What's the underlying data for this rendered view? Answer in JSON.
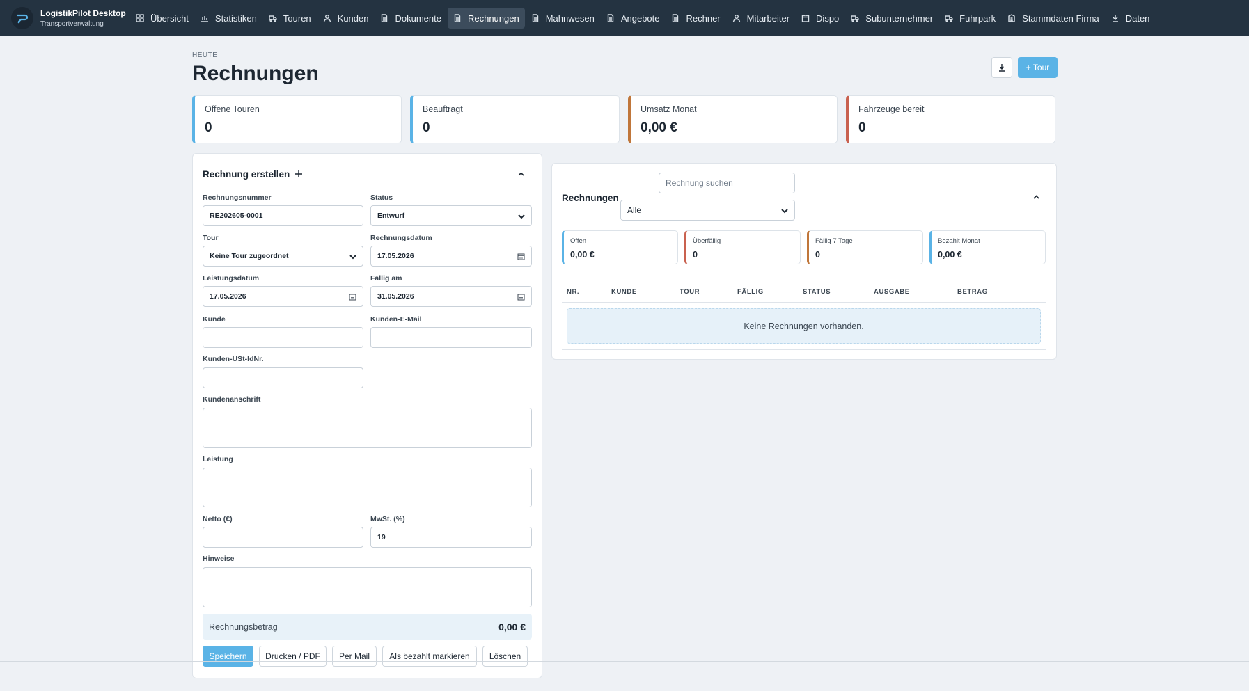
{
  "app": {
    "title": "LogistikPilot Desktop",
    "subtitle": "Transportverwaltung"
  },
  "nav": [
    {
      "label": "Übersicht",
      "icon": "dashboard-icon"
    },
    {
      "label": "Statistiken",
      "icon": "chart-icon"
    },
    {
      "label": "Touren",
      "icon": "truck-icon"
    },
    {
      "label": "Kunden",
      "icon": "user-icon"
    },
    {
      "label": "Dokumente",
      "icon": "document-icon"
    },
    {
      "label": "Rechnungen",
      "icon": "document-icon",
      "active": true
    },
    {
      "label": "Mahnwesen",
      "icon": "document-icon"
    },
    {
      "label": "Angebote",
      "icon": "document-icon"
    },
    {
      "label": "Rechner",
      "icon": "document-icon"
    },
    {
      "label": "Mitarbeiter",
      "icon": "user-icon"
    },
    {
      "label": "Dispo",
      "icon": "calendar-icon"
    },
    {
      "label": "Subunternehmer",
      "icon": "truck-icon"
    },
    {
      "label": "Fuhrpark",
      "icon": "truck-icon"
    },
    {
      "label": "Stammdaten Firma",
      "icon": "building-icon"
    },
    {
      "label": "Daten",
      "icon": "download-icon"
    }
  ],
  "header": {
    "eyebrow": "HEUTE",
    "title": "Rechnungen",
    "new_tour": "+ Tour"
  },
  "stats": [
    {
      "label": "Offene Touren",
      "value": "0",
      "color": "#5ab3e6"
    },
    {
      "label": "Beauftragt",
      "value": "0",
      "color": "#5ab3e6"
    },
    {
      "label": "Umsatz Monat",
      "value": "0,00 €",
      "color": "#c0763a"
    },
    {
      "label": "Fahrzeuge bereit",
      "value": "0",
      "color": "#c9614f"
    }
  ],
  "form": {
    "title": "Rechnung erstellen",
    "invoice_number_label": "Rechnungsnummer",
    "invoice_number": "RE202605-0001",
    "status_label": "Status",
    "status": "Entwurf",
    "tour_label": "Tour",
    "tour": "Keine Tour zugeordnet",
    "invoice_date_label": "Rechnungsdatum",
    "invoice_date": "17.05.2026",
    "service_date_label": "Leistungsdatum",
    "service_date": "17.05.2026",
    "due_label": "Fällig am",
    "due_date": "31.05.2026",
    "customer_label": "Kunde",
    "customer": "",
    "email_label": "Kunden-E-Mail",
    "email": "",
    "vat_id_label": "Kunden-USt-IdNr.",
    "vat_id": "",
    "address_label": "Kundenanschrift",
    "address": "",
    "service_label": "Leistung",
    "service": "",
    "net_label": "Netto (€)",
    "net": "",
    "vat_label": "MwSt. (%)",
    "vat": "19",
    "notes_label": "Hinweise",
    "notes": "",
    "total_label": "Rechnungsbetrag",
    "total": "0,00 €",
    "buttons": {
      "save": "Speichern",
      "print": "Drucken / PDF",
      "mail": "Per Mail",
      "paid": "Als bezahlt markieren",
      "delete": "Löschen"
    }
  },
  "list": {
    "title": "Rechnungen",
    "search_placeholder": "Rechnung suchen",
    "filter": "Alle",
    "summary": [
      {
        "label": "Offen",
        "value": "0,00 €",
        "color": "#5ab3e6"
      },
      {
        "label": "Überfällig",
        "value": "0",
        "color": "#c9614f"
      },
      {
        "label": "Fällig 7 Tage",
        "value": "0",
        "color": "#c0763a"
      },
      {
        "label": "Bezahlt Monat",
        "value": "0,00 €",
        "color": "#5ab3e6"
      }
    ],
    "columns": [
      "NR.",
      "KUNDE",
      "TOUR",
      "FÄLLIG",
      "STATUS",
      "AUSGABE",
      "BETRAG"
    ],
    "empty": "Keine Rechnungen vorhanden."
  }
}
